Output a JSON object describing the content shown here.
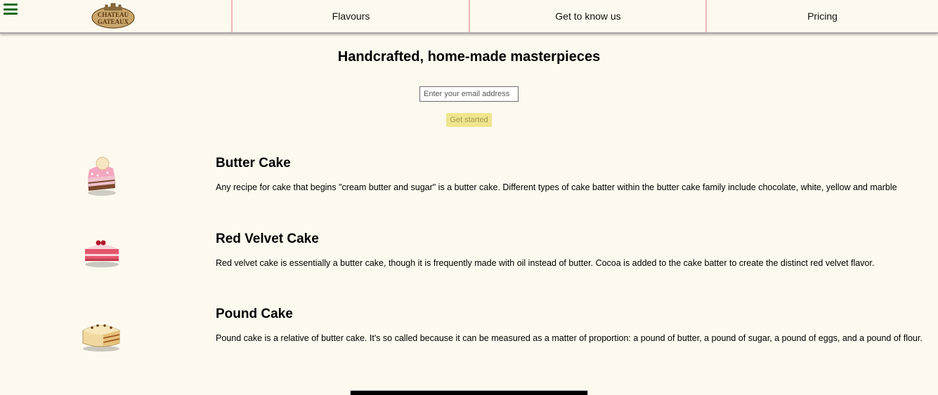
{
  "header": {
    "logo_line1": "CHATEAU",
    "logo_line2": "GATEAUX",
    "nav": [
      {
        "label": "Flavours"
      },
      {
        "label": "Get to know us"
      },
      {
        "label": "Pricing"
      }
    ]
  },
  "hero": {
    "title": "Handcrafted, home-made masterpieces",
    "email_placeholder": "Enter your email address",
    "button_label": "Get started"
  },
  "cakes": [
    {
      "title": "Butter Cake",
      "description": "Any recipe for cake that begins \"cream butter and sugar\" is a butter cake. Different types of cake batter within the butter cake family include chocolate, white, yellow and marble",
      "icon": "butter-cake-icon"
    },
    {
      "title": "Red Velvet Cake",
      "description": "Red velvet cake is essentially a butter cake, though it is frequently made with oil instead of butter. Cocoa is added to the cake batter to create the distinct red velvet flavor.",
      "icon": "red-velvet-cake-icon"
    },
    {
      "title": "Pound Cake",
      "description": "Pound cake is a relative of butter cake. It's so called because it can be measured as a matter of proportion: a pound of butter, a pound of sugar, a pound of eggs, and a pound of flour.",
      "icon": "pound-cake-icon"
    }
  ],
  "colors": {
    "background": "#fdf9ee",
    "menu_icon": "#1a6b1a",
    "nav_divider": "#f0b6b6",
    "button_bg": "#eee58e",
    "button_text": "#a39a52"
  }
}
